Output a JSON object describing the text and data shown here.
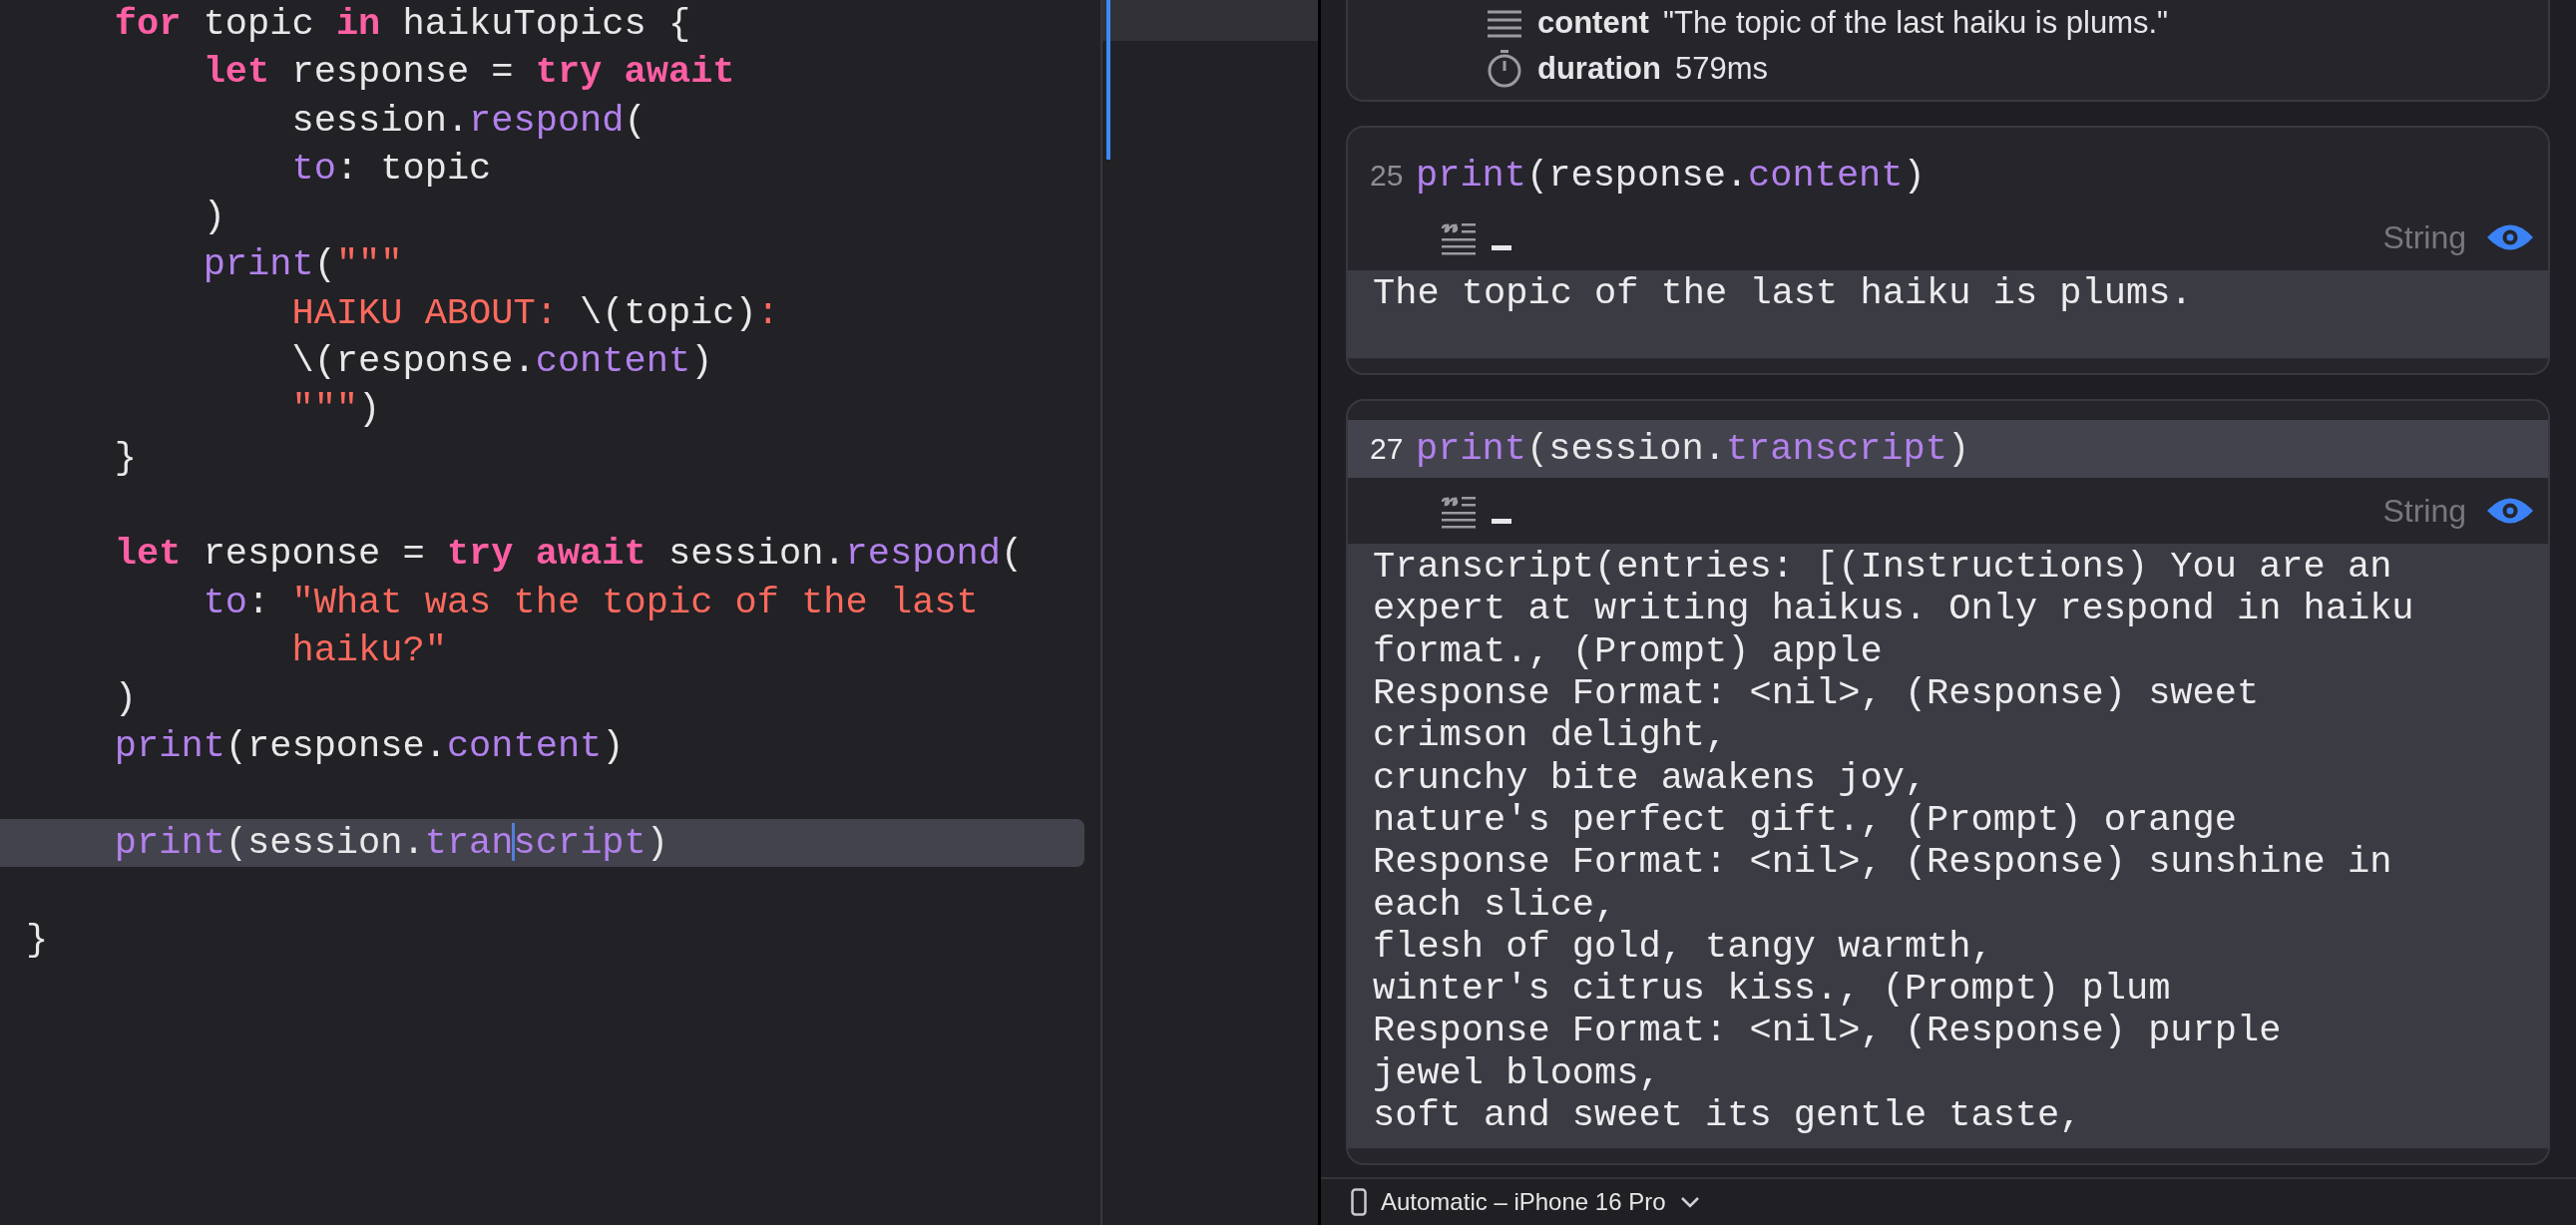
{
  "editor": {
    "lines": [
      {
        "current": false,
        "tokens": [
          {
            "kind": "tab"
          },
          {
            "kind": "keyword",
            "text": "for"
          },
          {
            "kind": "plain",
            "text": " topic "
          },
          {
            "kind": "keyword",
            "text": "in"
          },
          {
            "kind": "plain",
            "text": " haikuTopics {"
          }
        ]
      },
      {
        "current": false,
        "tokens": [
          {
            "kind": "tab"
          },
          {
            "kind": "tab"
          },
          {
            "kind": "keyword",
            "text": "let"
          },
          {
            "kind": "plain",
            "text": " response = "
          },
          {
            "kind": "keyword",
            "text": "try await"
          }
        ]
      },
      {
        "current": false,
        "tokens": [
          {
            "kind": "tab"
          },
          {
            "kind": "tab"
          },
          {
            "kind": "tab"
          },
          {
            "kind": "plain",
            "text": "session."
          },
          {
            "kind": "member",
            "text": "respond"
          },
          {
            "kind": "plain",
            "text": "("
          }
        ]
      },
      {
        "current": false,
        "tokens": [
          {
            "kind": "tab"
          },
          {
            "kind": "tab"
          },
          {
            "kind": "tab"
          },
          {
            "kind": "member",
            "text": "to"
          },
          {
            "kind": "plain",
            "text": ": topic"
          }
        ]
      },
      {
        "current": false,
        "tokens": [
          {
            "kind": "tab"
          },
          {
            "kind": "tab"
          },
          {
            "kind": "plain",
            "text": ")"
          }
        ]
      },
      {
        "current": false,
        "tokens": [
          {
            "kind": "tab"
          },
          {
            "kind": "tab"
          },
          {
            "kind": "member",
            "text": "print"
          },
          {
            "kind": "plain",
            "text": "("
          },
          {
            "kind": "string",
            "text": "\"\"\""
          }
        ]
      },
      {
        "current": false,
        "tokens": [
          {
            "kind": "tab"
          },
          {
            "kind": "tab"
          },
          {
            "kind": "tab"
          },
          {
            "kind": "string",
            "text": "HAIKU ABOUT: "
          },
          {
            "kind": "plain",
            "text": "\\(topic)"
          },
          {
            "kind": "string",
            "text": ":"
          }
        ]
      },
      {
        "current": false,
        "tokens": [
          {
            "kind": "tab"
          },
          {
            "kind": "tab"
          },
          {
            "kind": "tab"
          },
          {
            "kind": "plain",
            "text": "\\(response."
          },
          {
            "kind": "member",
            "text": "content"
          },
          {
            "kind": "plain",
            "text": ")"
          }
        ]
      },
      {
        "current": false,
        "tokens": [
          {
            "kind": "tab"
          },
          {
            "kind": "tab"
          },
          {
            "kind": "tab"
          },
          {
            "kind": "string",
            "text": "\"\"\""
          },
          {
            "kind": "plain",
            "text": ")"
          }
        ]
      },
      {
        "current": false,
        "tokens": [
          {
            "kind": "tab"
          },
          {
            "kind": "plain",
            "text": "}"
          }
        ]
      },
      {
        "current": false
      },
      {
        "current": false,
        "tokens": [
          {
            "kind": "tab"
          },
          {
            "kind": "keyword",
            "text": "let"
          },
          {
            "kind": "plain",
            "text": " response = "
          },
          {
            "kind": "keyword",
            "text": "try await"
          },
          {
            "kind": "plain",
            "text": " session."
          },
          {
            "kind": "member",
            "text": "respond"
          },
          {
            "kind": "plain",
            "text": "("
          }
        ]
      },
      {
        "current": false,
        "tokens": [
          {
            "kind": "tab"
          },
          {
            "kind": "tab"
          },
          {
            "kind": "member",
            "text": "to"
          },
          {
            "kind": "plain",
            "text": ": "
          },
          {
            "kind": "string",
            "text": "\"What was the topic of the last"
          }
        ]
      },
      {
        "current": false,
        "tokens": [
          {
            "kind": "tab"
          },
          {
            "kind": "tab"
          },
          {
            "kind": "tab"
          },
          {
            "kind": "string",
            "text": "haiku?\""
          }
        ]
      },
      {
        "current": false,
        "tokens": [
          {
            "kind": "tab"
          },
          {
            "kind": "plain",
            "text": ")"
          }
        ]
      },
      {
        "current": false,
        "tokens": [
          {
            "kind": "tab"
          },
          {
            "kind": "member",
            "text": "print"
          },
          {
            "kind": "plain",
            "text": "(response."
          },
          {
            "kind": "member",
            "text": "content"
          },
          {
            "kind": "plain",
            "text": ")"
          }
        ]
      },
      {
        "current": false
      },
      {
        "current": true,
        "tokens": [
          {
            "kind": "tab"
          },
          {
            "kind": "member",
            "text": "print"
          },
          {
            "kind": "plain",
            "text": "(session."
          },
          {
            "kind": "member",
            "text": "tran"
          },
          {
            "kind": "caret"
          },
          {
            "kind": "member",
            "text": "script"
          },
          {
            "kind": "plain",
            "text": ")"
          }
        ]
      },
      {
        "current": false
      },
      {
        "current": false,
        "tokens": [
          {
            "kind": "plain",
            "text": "}"
          }
        ]
      }
    ]
  },
  "results": {
    "summary": {
      "rows": [
        {
          "kind": "text",
          "label": "content",
          "value": "\"The topic of the last haiku is plums.\""
        },
        {
          "kind": "duration",
          "label": "duration",
          "value": "579ms"
        }
      ]
    },
    "cards": [
      {
        "line_number": "25",
        "highlighted": false,
        "tokens": [
          {
            "kind": "member",
            "text": "print"
          },
          {
            "kind": "plain",
            "text": "(response."
          },
          {
            "kind": "member",
            "text": "content"
          },
          {
            "kind": "plain",
            "text": ")"
          }
        ],
        "type": "String",
        "output": [
          "The topic of the last haiku is plums."
        ]
      },
      {
        "line_number": "27",
        "highlighted": true,
        "tokens": [
          {
            "kind": "member",
            "text": "print"
          },
          {
            "kind": "plain",
            "text": "(session."
          },
          {
            "kind": "member",
            "text": "transcript"
          },
          {
            "kind": "plain",
            "text": ")"
          }
        ],
        "type": "String",
        "output": [
          "Transcript(entries: [(Instructions) You are an",
          "expert at writing haikus. Only respond in haiku",
          "format., (Prompt) apple",
          "Response Format: <nil>, (Response) sweet",
          "crimson delight,",
          "crunchy bite awakens joy,",
          "nature's perfect gift., (Prompt) orange",
          "Response Format: <nil>, (Response) sunshine in",
          "each slice,",
          "flesh of gold, tangy warmth,",
          "winter's citrus kiss., (Prompt) plum",
          "Response Format: <nil>, (Response) purple",
          "jewel blooms,",
          "soft and sweet its gentle taste,"
        ]
      }
    ]
  },
  "device_bar": {
    "label": "Automatic – iPhone 16 Pro"
  }
}
